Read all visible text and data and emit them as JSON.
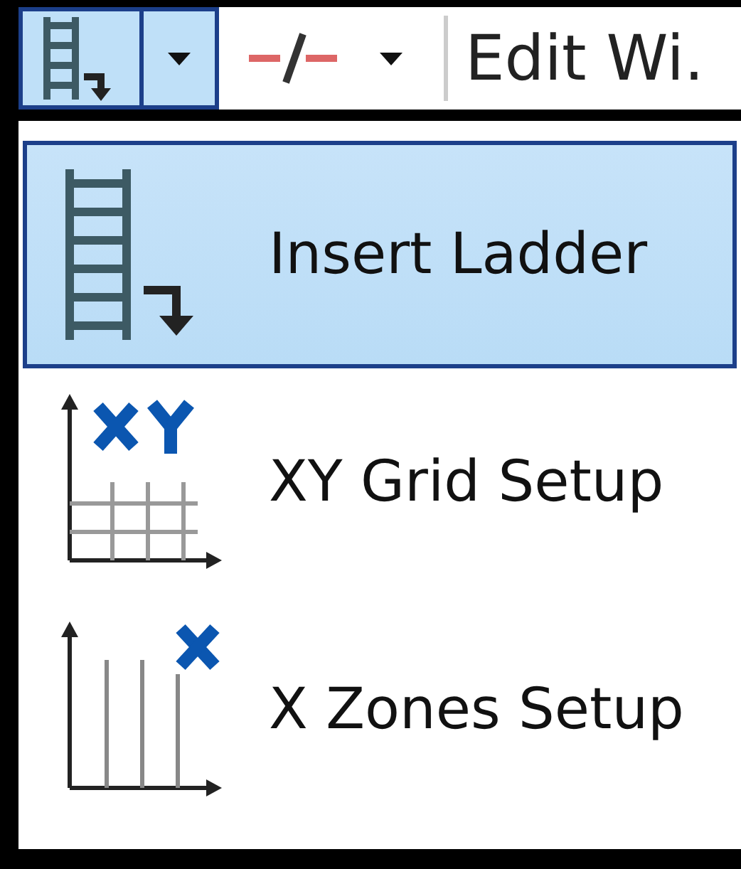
{
  "toolbar": {
    "split_button": {
      "pressed": true
    },
    "line_button": {
      "pressed": false
    },
    "edit_label": "Edit Wi."
  },
  "menu": {
    "items": [
      {
        "kind": "ladder",
        "label": "Insert Ladder",
        "selected": true
      },
      {
        "kind": "xygrid",
        "label": "XY Grid Setup",
        "selected": false
      },
      {
        "kind": "xzones",
        "label": "X Zones Setup",
        "selected": false
      }
    ]
  }
}
